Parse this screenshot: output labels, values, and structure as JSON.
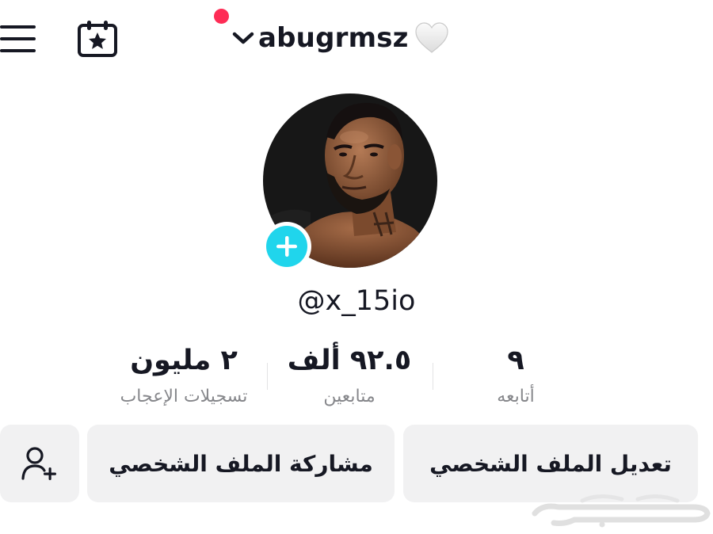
{
  "header": {
    "menu_icon": "hamburger-menu-icon",
    "calendar_icon": "calendar-star-icon",
    "username": "abugrmsz",
    "username_emoji": "white-heart-icon",
    "notification_color": "#fe2c55"
  },
  "profile": {
    "avatar": "profile-photo",
    "handle": "@x_15io",
    "add_badge_color": "#20d5ec"
  },
  "stats": [
    {
      "value": "٢ مليون",
      "label": "تسجيلات الإعجاب"
    },
    {
      "value": "٩٢.٥ ألف",
      "label": "متابعين"
    },
    {
      "value": "٩",
      "label": "أتابعه"
    }
  ],
  "buttons": {
    "add_friend_icon": "add-friend-icon",
    "share_profile": "مشاركة الملف الشخصي",
    "edit_profile": "تعديل الملف الشخصي"
  },
  "watermark": "حراج"
}
